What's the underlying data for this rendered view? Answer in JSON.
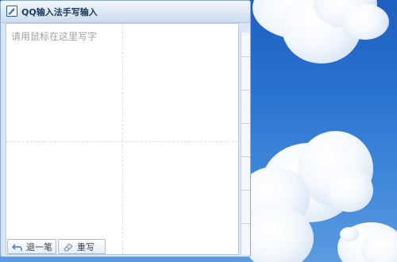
{
  "window": {
    "title": "QQ输入法手写输入"
  },
  "handwriting_pad": {
    "placeholder": "请用鼠标在这里写字"
  },
  "buttons": {
    "undo_label": "退一笔",
    "clear_label": "重写"
  },
  "icons": {
    "app": "handwriting-app-icon",
    "undo": "undo-arrow-icon",
    "clear": "eraser-icon"
  },
  "colors": {
    "title_text": "#1d3a5e",
    "placeholder_text": "#a2a2a2",
    "desktop_sky": "#2a72d0"
  }
}
